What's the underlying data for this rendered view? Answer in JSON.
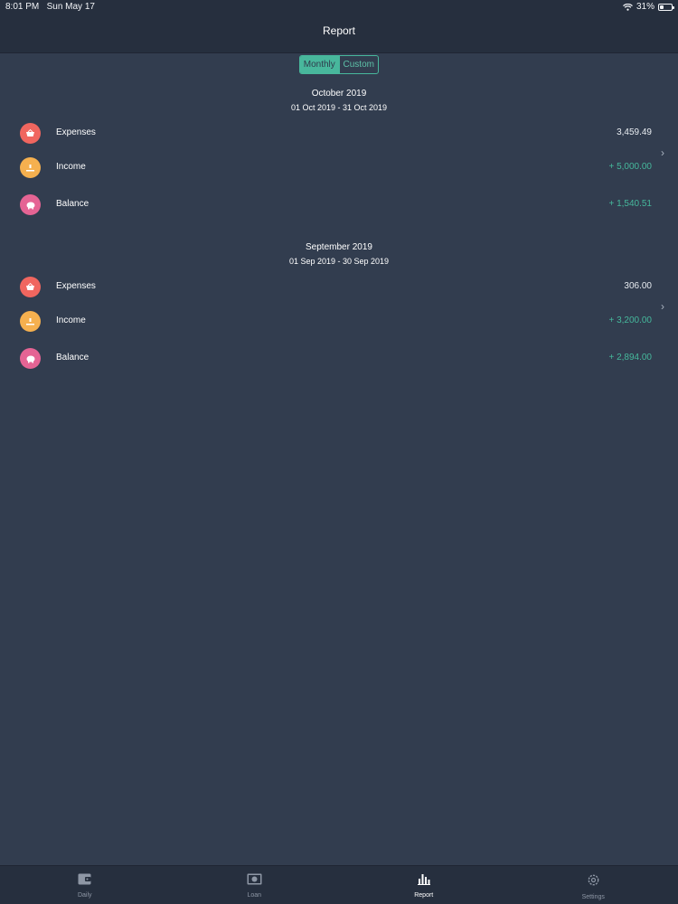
{
  "status": {
    "time": "8:01 PM",
    "date": "Sun May 17",
    "battery": "31%",
    "battery_level": 0.31
  },
  "header": {
    "title": "Report"
  },
  "segment": {
    "options": [
      "Monthly",
      "Custom"
    ],
    "selected": "Monthly"
  },
  "reports": [
    {
      "month": "October 2019",
      "range": "01 Oct 2019 - 31 Oct 2019",
      "rows": [
        {
          "label": "Expenses",
          "value": "3,459.49",
          "icon": "basket-icon",
          "color": "#f0665f"
        },
        {
          "label": "Income",
          "value": "+ 5,000.00",
          "icon": "money-hand-icon",
          "color": "#f5b04f"
        },
        {
          "label": "Balance",
          "value": "+ 1,540.51",
          "icon": "piggy-bank-icon",
          "color": "#e56494"
        }
      ]
    },
    {
      "month": "September 2019",
      "range": "01 Sep 2019 - 30 Sep 2019",
      "rows": [
        {
          "label": "Expenses",
          "value": "306.00",
          "icon": "basket-icon",
          "color": "#f0665f"
        },
        {
          "label": "Income",
          "value": "+ 3,200.00",
          "icon": "money-hand-icon",
          "color": "#f5b04f"
        },
        {
          "label": "Balance",
          "value": "+ 2,894.00",
          "icon": "piggy-bank-icon",
          "color": "#e56494"
        }
      ]
    }
  ],
  "tabs": [
    {
      "label": "Daily",
      "icon": "wallet-icon"
    },
    {
      "label": "Loan",
      "icon": "banknote-icon"
    },
    {
      "label": "Report",
      "icon": "bar-chart-icon",
      "active": true
    },
    {
      "label": "Settings",
      "icon": "gear-icon"
    }
  ]
}
